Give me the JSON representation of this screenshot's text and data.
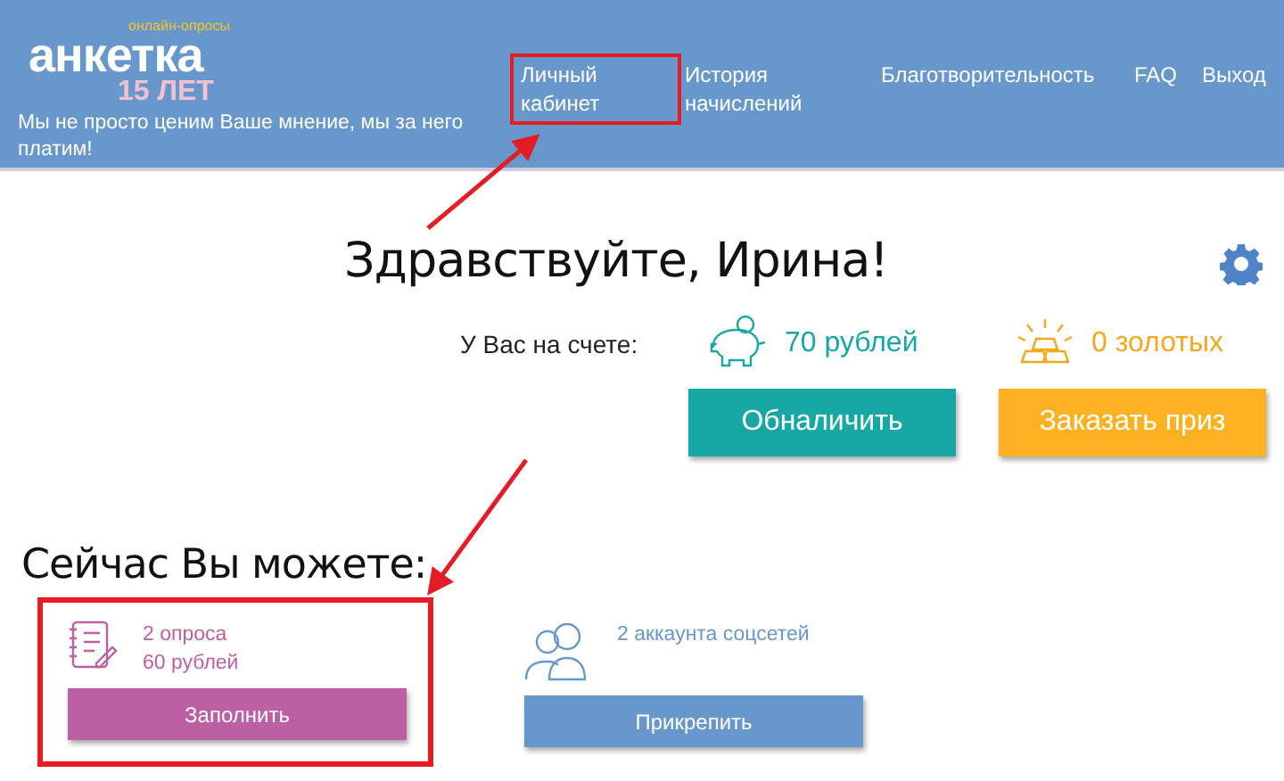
{
  "header": {
    "logo": {
      "tagline_small": "онлайн-опросы",
      "name": "анкетка",
      "anniversary": "15 ЛЕТ"
    },
    "slogan": "Мы не просто ценим Ваше мнение, мы за него платим!",
    "nav": [
      {
        "label": "Личный кабинет",
        "highlighted": true
      },
      {
        "label": "История начислений",
        "highlighted": false
      },
      {
        "label": "Благотворительность",
        "highlighted": false
      },
      {
        "label": "FAQ",
        "highlighted": false
      },
      {
        "label": "Выход",
        "highlighted": false
      }
    ]
  },
  "greeting": "Здравствуйте, Ирина!",
  "balance": {
    "label": "У Вас на счете:",
    "rubles": "70 рублей",
    "gold": "0 золотых",
    "cash_button": "Обналичить",
    "prize_button": "Заказать приз"
  },
  "actions_title": "Сейчас Вы можете:",
  "actions": [
    {
      "kind": "surveys",
      "lines": [
        "2 опроса",
        "60 рублей"
      ],
      "button": "Заполнить",
      "highlighted": true
    },
    {
      "kind": "social",
      "lines": [
        "2 аккаунта соцсетей"
      ],
      "button": "Прикрепить",
      "highlighted": false
    }
  ]
}
